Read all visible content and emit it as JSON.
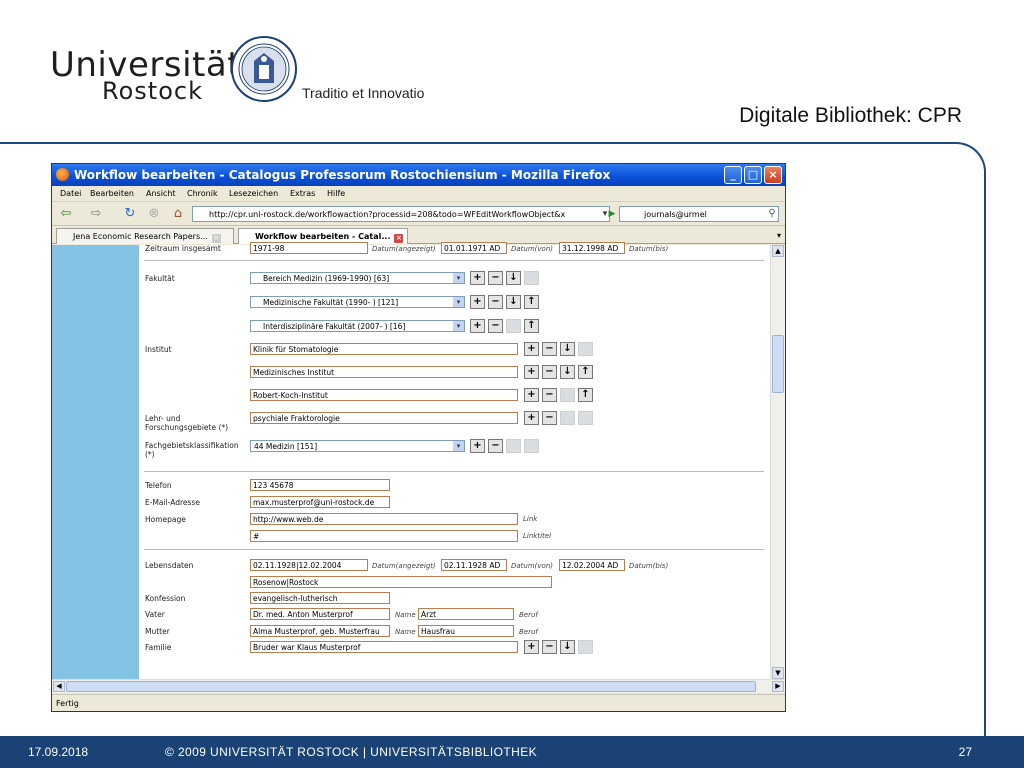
{
  "slide": {
    "university_line1": "Universität",
    "university_line2": "Rostock",
    "motto": "Traditio et Innovatio",
    "title": "Digitale Bibliothek: CPR",
    "footer_date": "17.09.2018",
    "footer_copyright": "©  2009  UNIVERSITÄT ROSTOCK | UNIVERSITÄTSBIBLIOTHEK",
    "footer_page": "27",
    "footer_color": "#1a4275",
    "seal_text": "Gegründet 1419"
  },
  "browser": {
    "title": "Workflow bearbeiten - Catalogus Professorum Rostochiensium - Mozilla Firefox",
    "menu": [
      "Datei",
      "Bearbeiten",
      "Ansicht",
      "Chronik",
      "Lesezeichen",
      "Extras",
      "Hilfe"
    ],
    "url": "http://cpr.uni-rostock.de/workflowaction?processid=208&todo=WFEditWorkflowObject&x",
    "search_value": "journals@urmel",
    "tabs": [
      {
        "label": "Jena Economic Research Papers..."
      },
      {
        "label": "Workflow bearbeiten - Catal..."
      }
    ],
    "status": "Fertig",
    "window_buttons": {
      "minimize": "_",
      "maximize": "□",
      "close": "×"
    }
  },
  "form": {
    "zeitraum": {
      "label": "Zeitraum insgesamt",
      "value": "1971-98",
      "datum_label": "Datum(angezeigt)",
      "von_value": "01.01.1971 AD",
      "von_label": "Datum(von)",
      "bis_value": "31.12.1998 AD",
      "bis_label": "Datum(bis)"
    },
    "fakultaet": {
      "label": "Fakultät",
      "options": [
        "Bereich Medizin (1969-1990) [63]",
        "Medizinische Fakultät (1990- ) [121]",
        "Interdisziplinäre Fakultät (2007- ) [16]"
      ]
    },
    "institut": {
      "label": "Institut",
      "values": [
        "Klinik für Stomatologie",
        "Medizinisches Institut",
        "Robert-Koch-Institut"
      ]
    },
    "lehr": {
      "label1": "Lehr- und",
      "label2": "Forschungsgebiete (*)",
      "value": "psychiale Fraktorologie"
    },
    "fach": {
      "label1": "Fachgebietsklassifikation",
      "label2": "(*)",
      "value": "44 Medizin [151]"
    },
    "telefon": {
      "label": "Telefon",
      "value": "123 45678"
    },
    "email": {
      "label": "E-Mail-Adresse",
      "value": "max.musterprof@uni-rostock.de"
    },
    "homepage": {
      "label": "Homepage",
      "url": "http://www.web.de",
      "url_label": "Link",
      "title": "#",
      "title_label": "Linktitel"
    },
    "lebensdaten": {
      "label": "Lebensdaten",
      "value": "02.11.1928|12.02.2004",
      "datum_label": "Datum(angezeigt)",
      "von_value": "02.11.1928 AD",
      "von_label": "Datum(von)",
      "bis_value": "12.02.2004 AD",
      "bis_label": "Datum(bis)",
      "orte": "Rosenow|Rostock"
    },
    "konfession": {
      "label": "Konfession",
      "value": "evangelisch-lutherisch"
    },
    "vater": {
      "label": "Vater",
      "name": "Dr. med. Anton Musterprof",
      "name_label": "Name",
      "beruf": "Arzt",
      "beruf_label": "Beruf"
    },
    "mutter": {
      "label": "Mutter",
      "name": "Alma Musterprof, geb. Musterfrau",
      "name_label": "Name",
      "beruf": "Hausfrau",
      "beruf_label": "Beruf"
    },
    "familie": {
      "label": "Familie",
      "value": "Bruder war Klaus Musterprof"
    }
  },
  "icons": {
    "plus": "+",
    "minus": "−",
    "down": "↓",
    "up": "↑",
    "back": "⇦",
    "forward": "⇨",
    "reload": "↻",
    "stop": "⊗",
    "home": "⌂",
    "go": "▶",
    "search": "⚲",
    "dropdown": "▾"
  }
}
